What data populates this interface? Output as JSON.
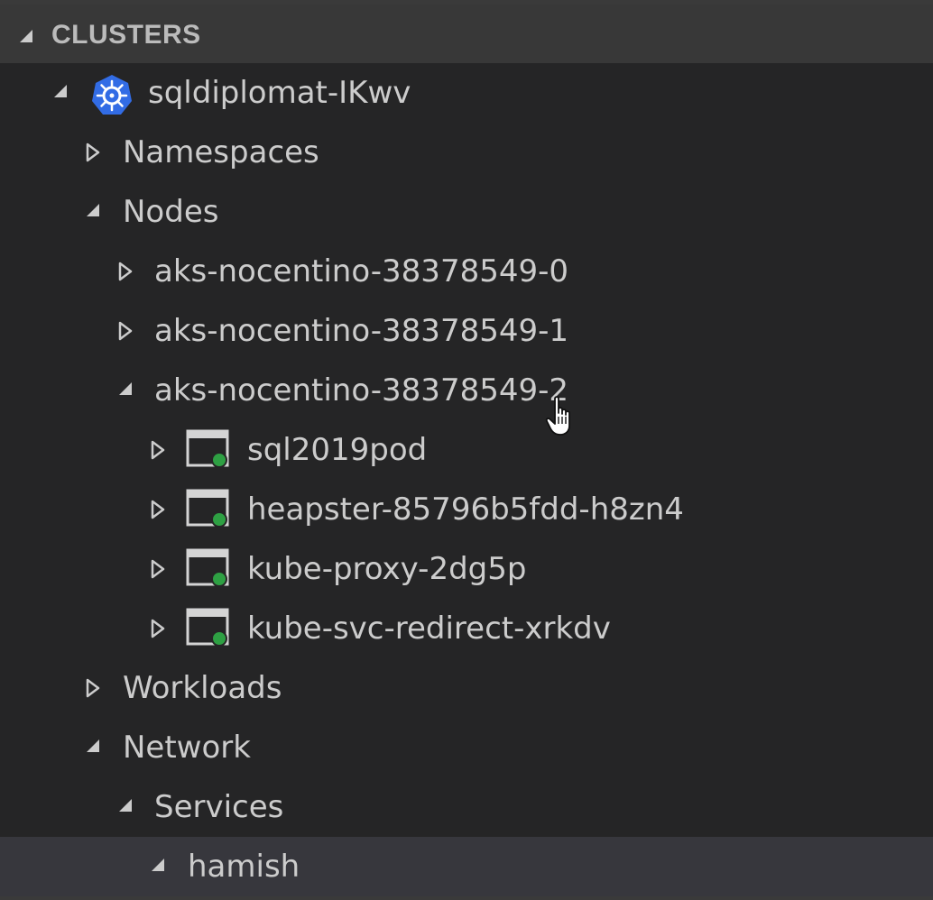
{
  "section": {
    "title": "CLUSTERS",
    "expanded": true
  },
  "cluster": {
    "name": "sqldiplomat-IKwv",
    "icon": "kubernetes-icon",
    "expanded": true
  },
  "tree": {
    "namespaces": {
      "label": "Namespaces",
      "expanded": false
    },
    "nodes": {
      "label": "Nodes",
      "expanded": true,
      "items": [
        {
          "label": "aks-nocentino-38378549-0",
          "expanded": false
        },
        {
          "label": "aks-nocentino-38378549-1",
          "expanded": false
        },
        {
          "label": "aks-nocentino-38378549-2",
          "expanded": true
        }
      ]
    },
    "pods": [
      {
        "label": "sql2019pod",
        "icon": "pod-icon",
        "status": "running"
      },
      {
        "label": "heapster-85796b5fdd-h8zn4",
        "icon": "pod-icon",
        "status": "running"
      },
      {
        "label": "kube-proxy-2dg5p",
        "icon": "pod-icon",
        "status": "running"
      },
      {
        "label": "kube-svc-redirect-xrkdv",
        "icon": "pod-icon",
        "status": "running"
      }
    ],
    "workloads": {
      "label": "Workloads",
      "expanded": false
    },
    "network": {
      "label": "Network",
      "expanded": true
    },
    "services": {
      "label": "Services",
      "expanded": true
    },
    "hamish": {
      "label": "hamish",
      "expanded": true,
      "selected": true
    }
  },
  "colors": {
    "background": "#252526",
    "header": "#383838",
    "selected_row": "#37373d",
    "text": "#cccccc",
    "status_running": "#2ea043",
    "kubernetes_blue": "#326ce5"
  },
  "cursor": "hand-pointer-icon"
}
